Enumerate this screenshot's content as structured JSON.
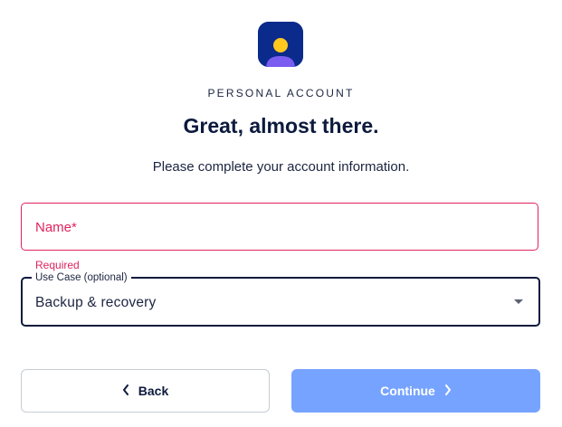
{
  "header": {
    "kicker": "PERSONAL ACCOUNT",
    "title": "Great, almost there.",
    "subtitle": "Please complete your account information."
  },
  "form": {
    "name": {
      "placeholder": "Name*",
      "value": "",
      "helper": "Required"
    },
    "use_case": {
      "label": "Use Case (optional)",
      "selected": "Backup & recovery"
    }
  },
  "actions": {
    "back_label": "Back",
    "continue_label": "Continue"
  },
  "colors": {
    "brand_navy": "#0a2a8c",
    "error": "#e0245e",
    "primary_disabled": "#76a3ff",
    "text_dark": "#0c1a3d"
  },
  "icons": {
    "logo": "person-avatar-logo-icon",
    "select_caret": "caret-down-icon",
    "back": "chevron-left-icon",
    "continue": "chevron-right-icon"
  }
}
